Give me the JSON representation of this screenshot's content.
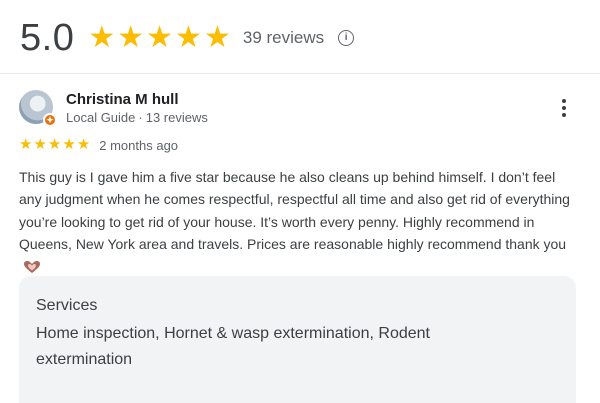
{
  "summary": {
    "rating": "5.0",
    "stars": 5,
    "review_count": "39 reviews",
    "info_icon": "info-circle-icon"
  },
  "review": {
    "author_name": "Christina M hull",
    "author_level": "Local Guide",
    "author_separator": "·",
    "author_reviews": "13 reviews",
    "stars": 5,
    "date": "2 months ago",
    "text": "This guy is I gave him a five star because he also cleans up behind himself. I don’t feel any judgment when he comes respectful, respectful all time and also get rid of everything you’re looking to get rid of your house. It’s worth every penny. Highly recommend in Queens, New York area and travels. Prices are reasonable highly recommend thank you",
    "emoji_icon": "heart-hands-icon"
  },
  "services": {
    "title": "Services",
    "list": "Home inspection, Hornet & wasp extermination, Rodent extermination"
  },
  "colors": {
    "star": "#fbbc04",
    "badge": "#e8710a",
    "services_bg": "#f1f3f4"
  }
}
